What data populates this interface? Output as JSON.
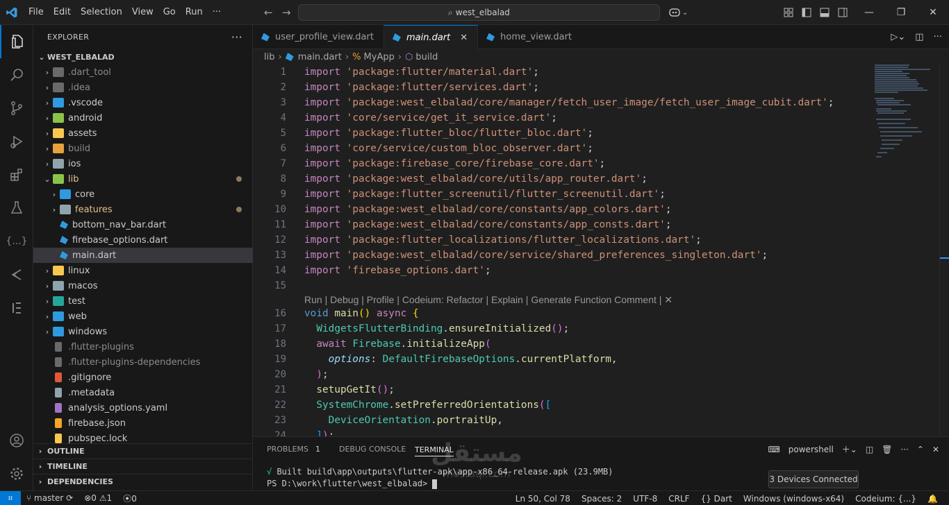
{
  "titlebar": {
    "menu": [
      "File",
      "Edit",
      "Selection",
      "View",
      "Go",
      "Run",
      "···"
    ],
    "search": "west_elbalad"
  },
  "explorer": {
    "header": "EXPLORER",
    "root": "WEST_ELBALAD",
    "items": [
      {
        "label": ".dart_tool",
        "depth": 0,
        "folder": true,
        "dim": true,
        "color": "#6a6a6a"
      },
      {
        "label": ".idea",
        "depth": 0,
        "folder": true,
        "dim": true,
        "color": "#6a6a6a"
      },
      {
        "label": ".vscode",
        "depth": 0,
        "folder": true,
        "color": "#2f9ae0"
      },
      {
        "label": "android",
        "depth": 0,
        "folder": true,
        "color": "#8bc34a"
      },
      {
        "label": "assets",
        "depth": 0,
        "folder": true,
        "color": "#f9c74f"
      },
      {
        "label": "build",
        "depth": 0,
        "folder": true,
        "dim": true,
        "color": "#e6a23c"
      },
      {
        "label": "ios",
        "depth": 0,
        "folder": true,
        "color": "#90a4ae"
      },
      {
        "label": "lib",
        "depth": 0,
        "folder": true,
        "open": true,
        "modified": true,
        "color": "#8bc34a"
      },
      {
        "label": "core",
        "depth": 1,
        "folder": true,
        "color": "#2f9ae0"
      },
      {
        "label": "features",
        "depth": 1,
        "folder": true,
        "modified": true,
        "color": "#90a4ae"
      },
      {
        "label": "bottom_nav_bar.dart",
        "depth": 1,
        "folder": false,
        "dart": true
      },
      {
        "label": "firebase_options.dart",
        "depth": 1,
        "folder": false,
        "dart": true
      },
      {
        "label": "main.dart",
        "depth": 1,
        "folder": false,
        "dart": true,
        "selected": true
      },
      {
        "label": "linux",
        "depth": 0,
        "folder": true,
        "color": "#f9c74f"
      },
      {
        "label": "macos",
        "depth": 0,
        "folder": true,
        "color": "#90a4ae"
      },
      {
        "label": "test",
        "depth": 0,
        "folder": true,
        "color": "#26a69a"
      },
      {
        "label": "web",
        "depth": 0,
        "folder": true,
        "color": "#2f9ae0"
      },
      {
        "label": "windows",
        "depth": 0,
        "folder": true,
        "color": "#2f9ae0"
      },
      {
        "label": ".flutter-plugins",
        "depth": 0,
        "folder": false,
        "dim": true,
        "color": "#6a6a6a"
      },
      {
        "label": ".flutter-plugins-dependencies",
        "depth": 0,
        "folder": false,
        "dim": true,
        "color": "#6a6a6a"
      },
      {
        "label": ".gitignore",
        "depth": 0,
        "folder": false,
        "color": "#e2573b"
      },
      {
        "label": ".metadata",
        "depth": 0,
        "folder": false,
        "color": "#90a4ae"
      },
      {
        "label": "analysis_options.yaml",
        "depth": 0,
        "folder": false,
        "color": "#a074c4"
      },
      {
        "label": "firebase.json",
        "depth": 0,
        "folder": false,
        "color": "#f6a623"
      },
      {
        "label": "pubspec.lock",
        "depth": 0,
        "folder": false,
        "color": "#f9c74f"
      }
    ],
    "sections": [
      "OUTLINE",
      "TIMELINE",
      "DEPENDENCIES"
    ]
  },
  "tabs": [
    {
      "label": "user_profile_view.dart",
      "active": false
    },
    {
      "label": "main.dart",
      "active": true
    },
    {
      "label": "home_view.dart",
      "active": false
    }
  ],
  "breadcrumb": [
    "lib",
    "main.dart",
    "MyApp",
    "build"
  ],
  "editor": {
    "imports": [
      "'package:flutter/material.dart'",
      "'package:flutter/services.dart'",
      "'package:west_elbalad/core/manager/fetch_user_image/fetch_user_image_cubit.dart'",
      "'core/service/get_it_service.dart'",
      "'package:flutter_bloc/flutter_bloc.dart'",
      "'core/service/custom_bloc_observer.dart'",
      "'package:firebase_core/firebase_core.dart'",
      "'package:west_elbalad/core/utils/app_router.dart'",
      "'package:flutter_screenutil/flutter_screenutil.dart'",
      "'package:west_elbalad/core/constants/app_colors.dart'",
      "'package:west_elbalad/core/constants/app_consts.dart'",
      "'package:flutter_localizations/flutter_localizations.dart'",
      "'package:west_elbalad/core/service/shared_preferences_singleton.dart'",
      "'firebase_options.dart'"
    ],
    "import_kw": "import",
    "codelens": "Run | Debug | Profile | Codeium: Refactor | Explain | Generate Function Comment | ✕",
    "line_numbers": [
      "1",
      "2",
      "3",
      "4",
      "5",
      "6",
      "7",
      "8",
      "9",
      "10",
      "11",
      "12",
      "13",
      "14",
      "15",
      "16",
      "17",
      "18",
      "19",
      "20",
      "21",
      "22",
      "23",
      "24"
    ]
  },
  "panel": {
    "tabs": [
      "PROBLEMS",
      "DEBUG CONSOLE",
      "TERMINAL"
    ],
    "problems_count": "1",
    "shell": "powershell",
    "terminal_line1_mark": "√",
    "terminal_line1": " Built build\\app\\outputs\\flutter-apk\\app-x86_64-release.apk (23.9MB)",
    "terminal_line2": "PS D:\\work\\flutter\\west_elbalad> ",
    "tooltip": "3 Devices Connected",
    "watermark_big": "مستقل",
    "watermark_small": "mostaql.com"
  },
  "statusbar": {
    "branch": "master",
    "errors": "0",
    "warnings": "1",
    "ports": "0",
    "position": "Ln 50, Col 78",
    "spaces": "Spaces: 2",
    "encoding": "UTF-8",
    "eol": "CRLF",
    "language": "Dart",
    "device": "Windows (windows-x64)",
    "codeium": "Codeium: {...}"
  },
  "colors": {
    "accent": "#0078d4",
    "keyword": "#c586c0",
    "string": "#ce9178",
    "function": "#dcdcaa"
  }
}
